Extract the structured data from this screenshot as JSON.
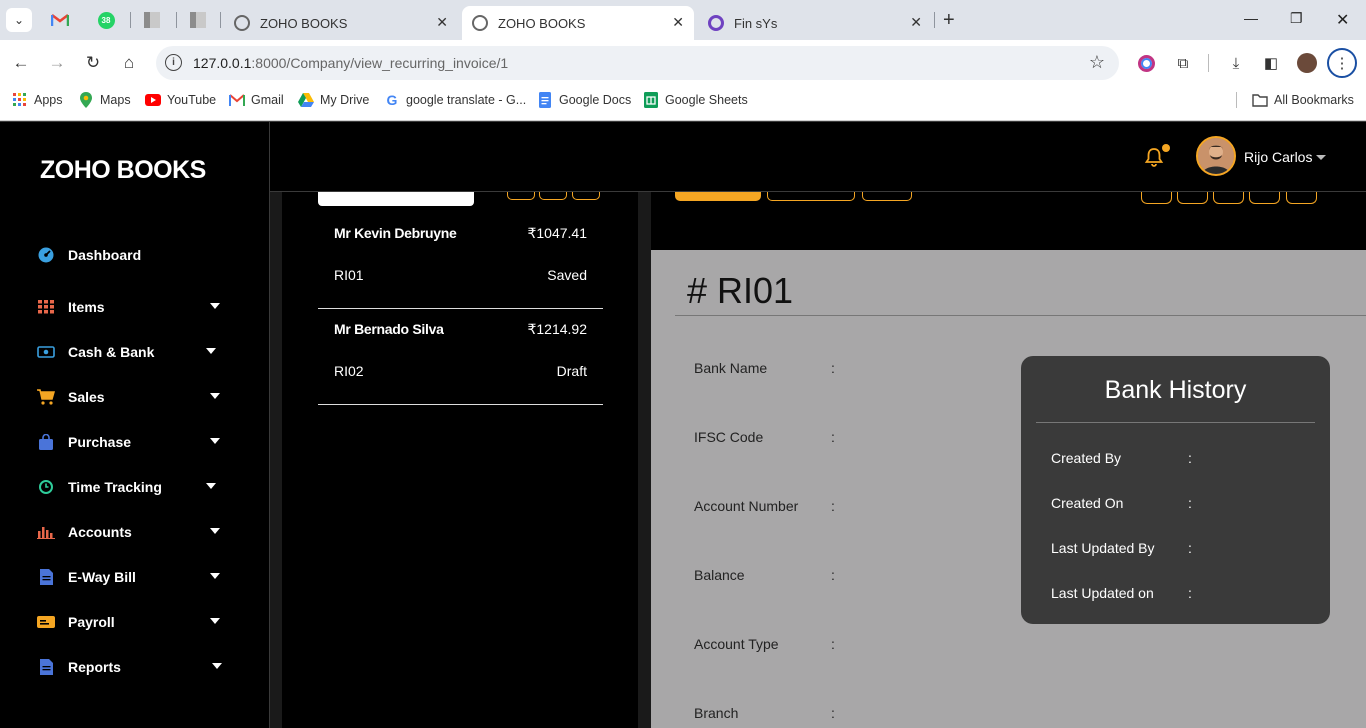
{
  "browser": {
    "tabs": [
      {
        "title": "ZOHO BOOKS",
        "active": false
      },
      {
        "title": "ZOHO BOOKS",
        "active": true
      },
      {
        "title": "Fin sYs",
        "active": false
      }
    ],
    "badge_count": "38",
    "url_host": "127.0.0.1",
    "url_path": ":8000/Company/view_recurring_invoice/1",
    "bookmarks": [
      {
        "label": "Apps",
        "icon": "apps-grid-icon"
      },
      {
        "label": "Maps",
        "icon": "maps-pin-icon"
      },
      {
        "label": "YouTube",
        "icon": "youtube-icon"
      },
      {
        "label": "Gmail",
        "icon": "gmail-icon"
      },
      {
        "label": "My Drive",
        "icon": "drive-icon"
      },
      {
        "label": "google translate - G...",
        "icon": "google-icon"
      },
      {
        "label": "Google Docs",
        "icon": "docs-icon"
      },
      {
        "label": "Google Sheets",
        "icon": "sheets-icon"
      }
    ],
    "all_bookmarks": "All Bookmarks"
  },
  "sidebar": {
    "brand": "ZOHO BOOKS",
    "items": [
      {
        "label": "Dashboard",
        "icon": "dashboard-icon",
        "has_caret": false
      },
      {
        "label": "Items",
        "icon": "items-grid-icon",
        "has_caret": true
      },
      {
        "label": "Cash & Bank",
        "icon": "cash-icon",
        "has_caret": true
      },
      {
        "label": "Sales",
        "icon": "cart-icon",
        "has_caret": true
      },
      {
        "label": "Purchase",
        "icon": "shopping-bag-icon",
        "has_caret": true
      },
      {
        "label": "Time Tracking",
        "icon": "clock-icon",
        "has_caret": true
      },
      {
        "label": "Accounts",
        "icon": "bar-chart-icon",
        "has_caret": true
      },
      {
        "label": "E-Way Bill",
        "icon": "document-icon",
        "has_caret": true
      },
      {
        "label": "Payroll",
        "icon": "payroll-card-icon",
        "has_caret": true
      },
      {
        "label": "Reports",
        "icon": "report-icon",
        "has_caret": true
      }
    ]
  },
  "header": {
    "user_name": "Rijo Carlos"
  },
  "invoices": [
    {
      "name": "Mr Kevin Debruyne",
      "amount": "₹1047.41",
      "id": "RI01",
      "status": "Saved"
    },
    {
      "name": "Mr Bernado Silva",
      "amount": "₹1214.92",
      "id": "RI02",
      "status": "Draft"
    }
  ],
  "detail": {
    "title": "# RI01",
    "fields": [
      {
        "label": "Bank Name",
        "colon": ":"
      },
      {
        "label": "IFSC Code",
        "colon": ":"
      },
      {
        "label": "Account Number",
        "colon": ":"
      },
      {
        "label": "Balance",
        "colon": ":"
      },
      {
        "label": "Account Type",
        "colon": ":"
      },
      {
        "label": "Branch",
        "colon": ":"
      }
    ]
  },
  "history": {
    "title": "Bank History",
    "rows": [
      {
        "label": "Created By",
        "colon": ":"
      },
      {
        "label": "Created On",
        "colon": ":"
      },
      {
        "label": "Last Updated By",
        "colon": ":"
      },
      {
        "label": "Last Updated on",
        "colon": ":"
      }
    ]
  },
  "colors": {
    "accent": "#f5a623",
    "panel": "#a8a7a8",
    "card": "#3a3a3a"
  }
}
